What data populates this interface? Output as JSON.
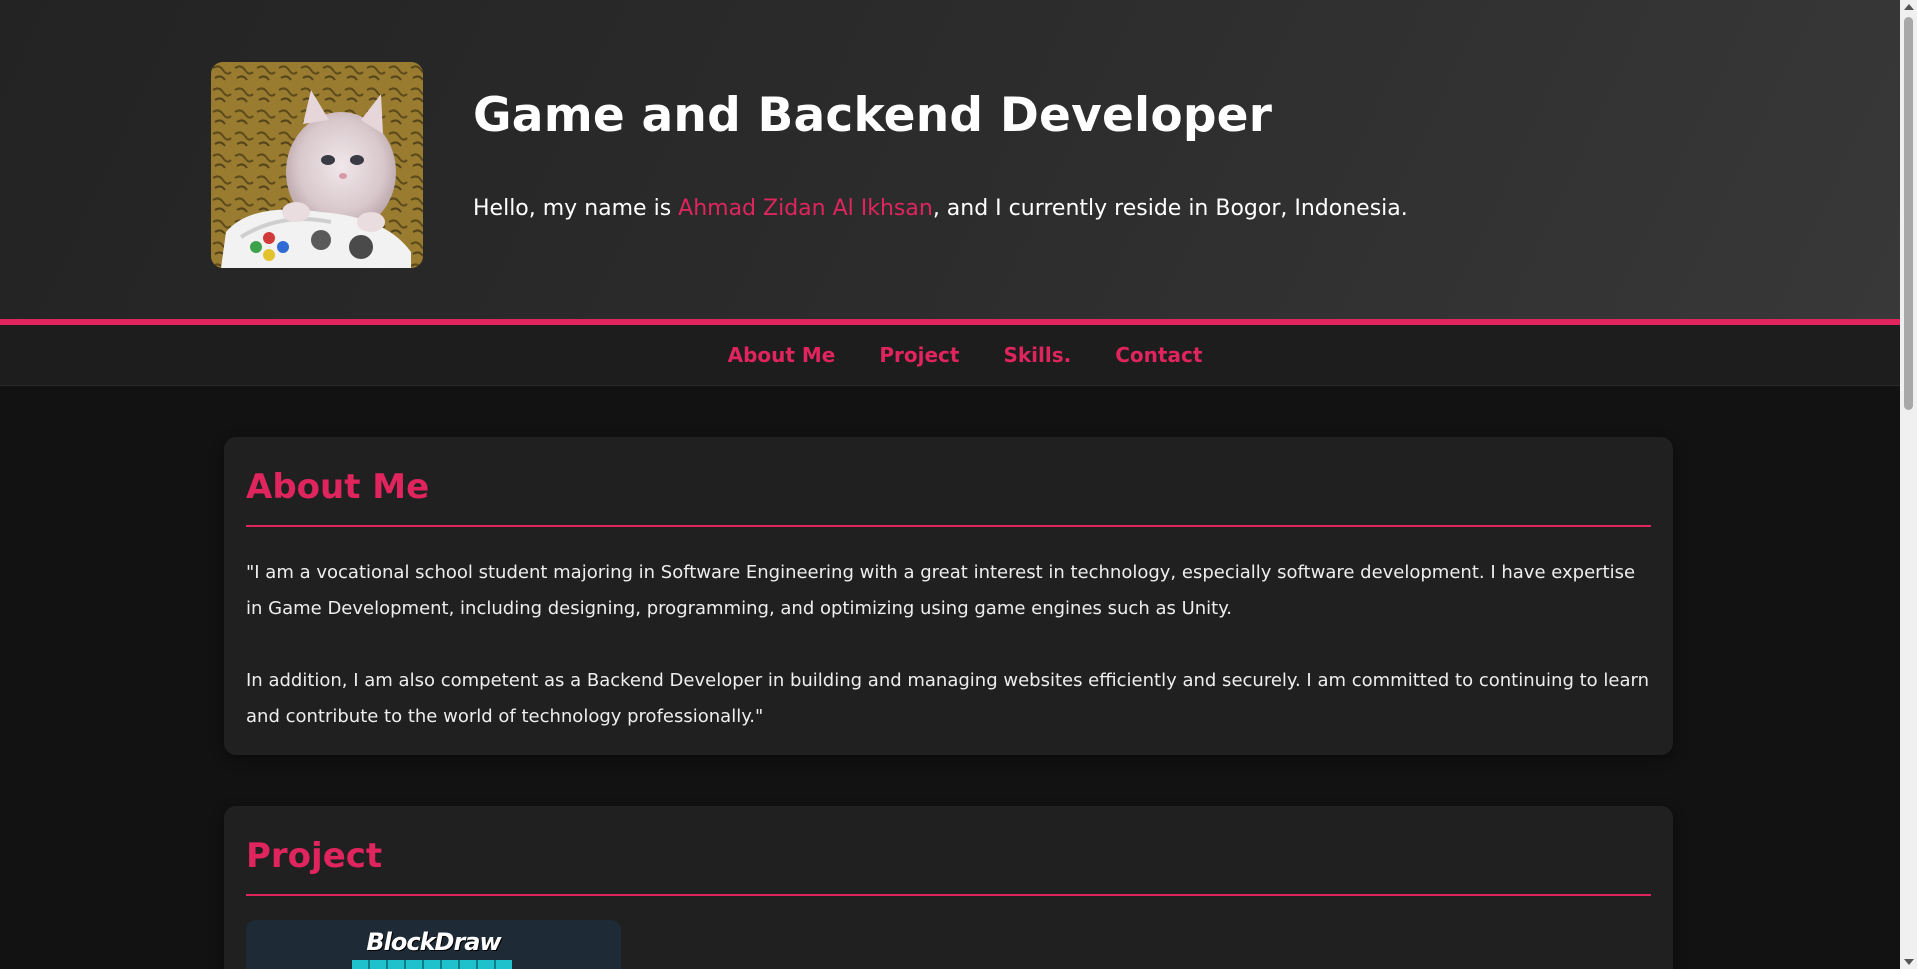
{
  "header": {
    "title": "Game and Backend Developer",
    "intro_prefix": "Hello, my name is ",
    "name": "Ahmad Zidan Al Ikhsan",
    "intro_suffix": ", and I currently reside in Bogor, Indonesia."
  },
  "nav": {
    "items": [
      {
        "label": "About Me"
      },
      {
        "label": "Project"
      },
      {
        "label": "Skills."
      },
      {
        "label": "Contact"
      }
    ]
  },
  "about": {
    "heading": "About Me",
    "paragraphs": [
      "\"I am a vocational school student majoring in Software Engineering with a great interest in technology, especially software development. I have expertise in Game Development, including designing, programming, and optimizing using game engines such as Unity.",
      "In addition, I am also competent as a Backend Developer in building and managing websites efficiently and securely. I am committed to continuing to learn and contribute to the world of technology professionally.\""
    ]
  },
  "project": {
    "heading": "Project",
    "items": [
      {
        "title": "BlockDraw"
      }
    ]
  },
  "colors": {
    "accent": "#e0245e",
    "background": "#121212",
    "card": "#202020"
  },
  "icons": {
    "avatar": "kitten-with-controller-photo"
  }
}
